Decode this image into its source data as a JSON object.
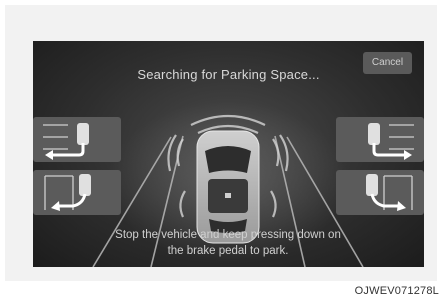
{
  "screen": {
    "title": "Searching for Parking Space...",
    "cancel_label": "Cancel",
    "instruction_line1": "Stop the vehicle and keep pressing down on",
    "instruction_line2": "the brake pedal to park."
  },
  "options": [
    {
      "name": "left-perpendicular",
      "icon": "car-reverse-left-perpendicular-icon"
    },
    {
      "name": "left-parallel",
      "icon": "car-reverse-left-parallel-icon"
    },
    {
      "name": "right-perpendicular",
      "icon": "car-reverse-right-perpendicular-icon"
    },
    {
      "name": "right-parallel",
      "icon": "car-reverse-right-parallel-icon"
    }
  ],
  "figure_code": "OJWEV071278L"
}
